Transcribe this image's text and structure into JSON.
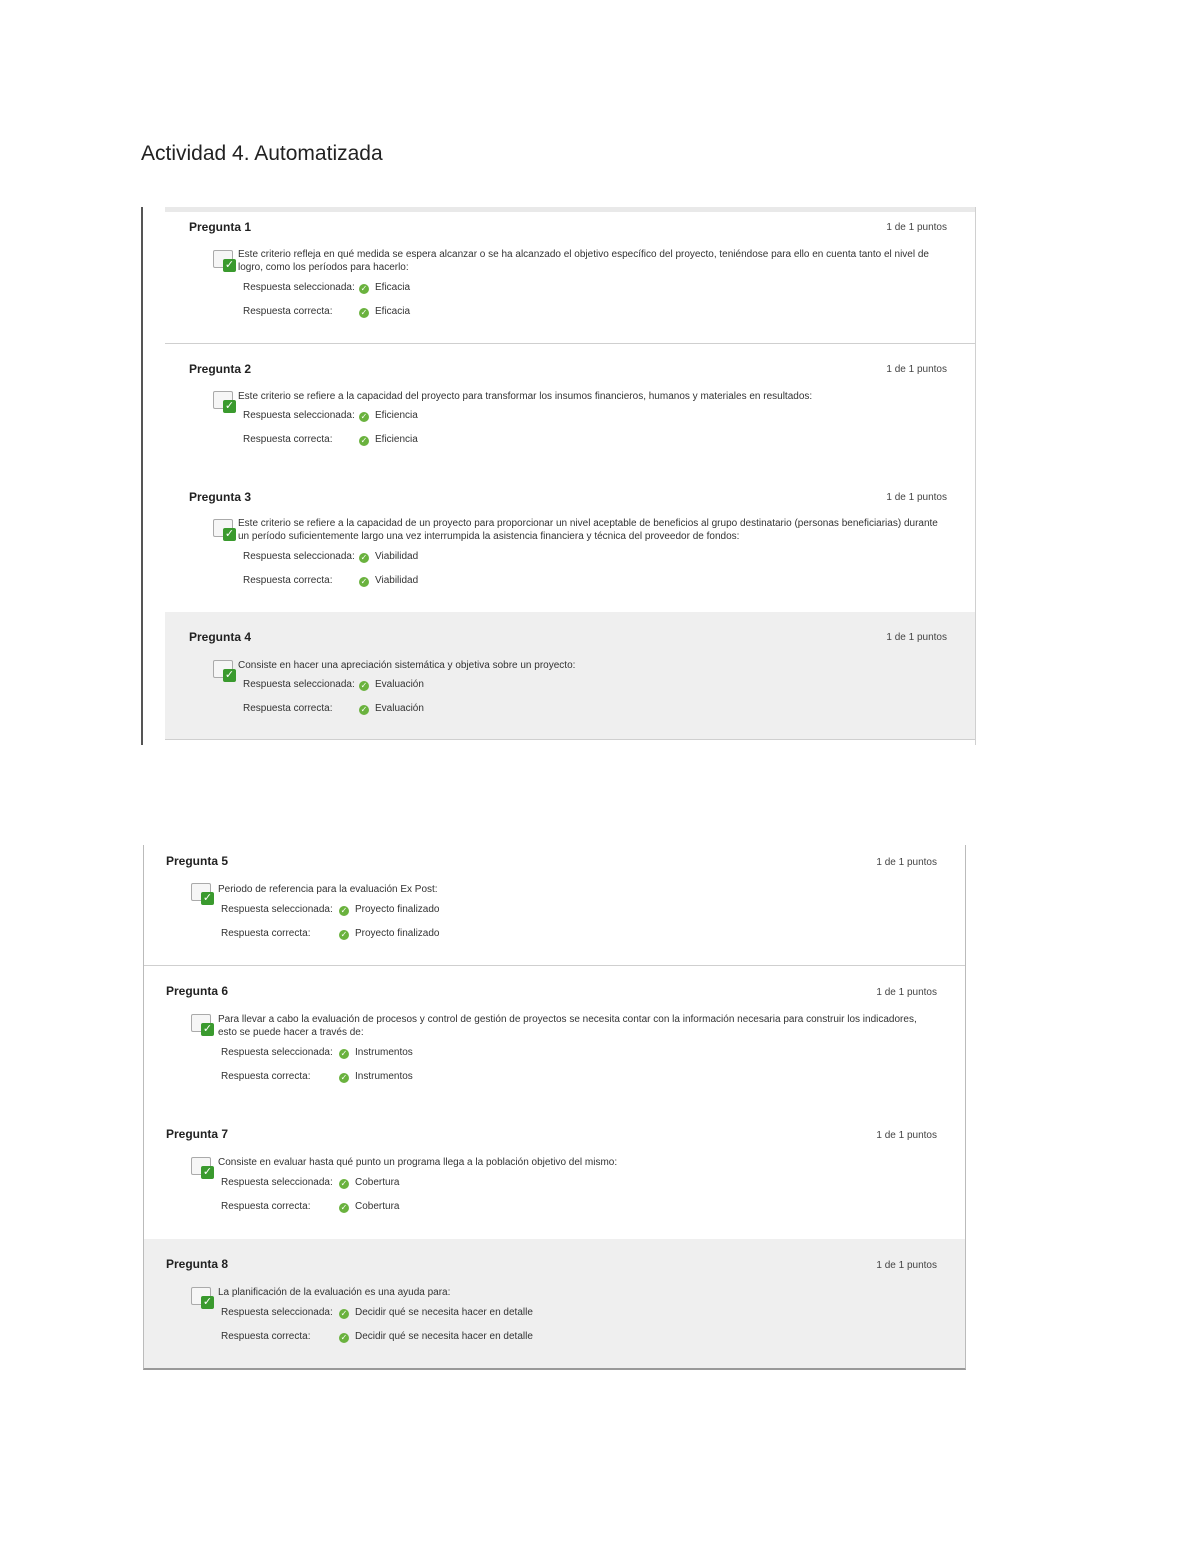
{
  "document": {
    "title": "Actividad 4. Automatizada"
  },
  "quiz": {
    "selected_label": "Respuesta seleccionada:",
    "correct_label": "Respuesta correcta:",
    "questions": [
      {
        "title": "Pregunta 1",
        "points": "1 de 1 puntos",
        "text": "Este criterio refleja en qué medida se espera alcanzar o se ha alcanzado el objetivo específico del proyecto, teniéndose para ello en cuenta tanto el nivel de logro, como los períodos para hacerlo:",
        "selected": "Eficacia",
        "correct": "Eficacia"
      },
      {
        "title": "Pregunta 2",
        "points": "1 de 1 puntos",
        "text": "Este criterio se refiere a la capacidad del proyecto para transformar los insumos financieros, humanos y materiales en resultados:",
        "selected": "Eficiencia",
        "correct": "Eficiencia"
      },
      {
        "title": "Pregunta 3",
        "points": "1 de 1 puntos",
        "text": "Este criterio se refiere a la capacidad de un proyecto para proporcionar un nivel aceptable de beneficios al grupo destinatario (personas beneficiarias) durante un período suficientemente largo una vez interrumpida la asistencia financiera y técnica del proveedor de fondos:",
        "selected": "Viabilidad",
        "correct": "Viabilidad"
      },
      {
        "title": "Pregunta 4",
        "points": "1 de 1 puntos",
        "text": "Consiste en hacer una apreciación sistemática y objetiva sobre un proyecto:",
        "selected": "Evaluación",
        "correct": "Evaluación"
      },
      {
        "title": "Pregunta 5",
        "points": "1 de 1 puntos",
        "text": "Periodo de referencia para la evaluación Ex Post:",
        "selected": "Proyecto finalizado",
        "correct": "Proyecto finalizado"
      },
      {
        "title": "Pregunta 6",
        "points": "1 de 1 puntos",
        "text": "Para llevar a cabo la evaluación de procesos y control de gestión de proyectos se necesita contar con la información necesaria para construir los indicadores, esto se puede hacer a través de:",
        "selected": "Instrumentos",
        "correct": "Instrumentos"
      },
      {
        "title": "Pregunta 7",
        "points": "1 de 1 puntos",
        "text": "Consiste en evaluar hasta qué punto un programa llega a la población objetivo del mismo:",
        "selected": "Cobertura",
        "correct": "Cobertura"
      },
      {
        "title": "Pregunta 8",
        "points": "1 de 1 puntos",
        "text": "La planificación de la evaluación es una ayuda para:",
        "selected": "Decidir qué se necesita hacer en detalle",
        "correct": "Decidir qué se necesita hacer en detalle"
      }
    ]
  }
}
